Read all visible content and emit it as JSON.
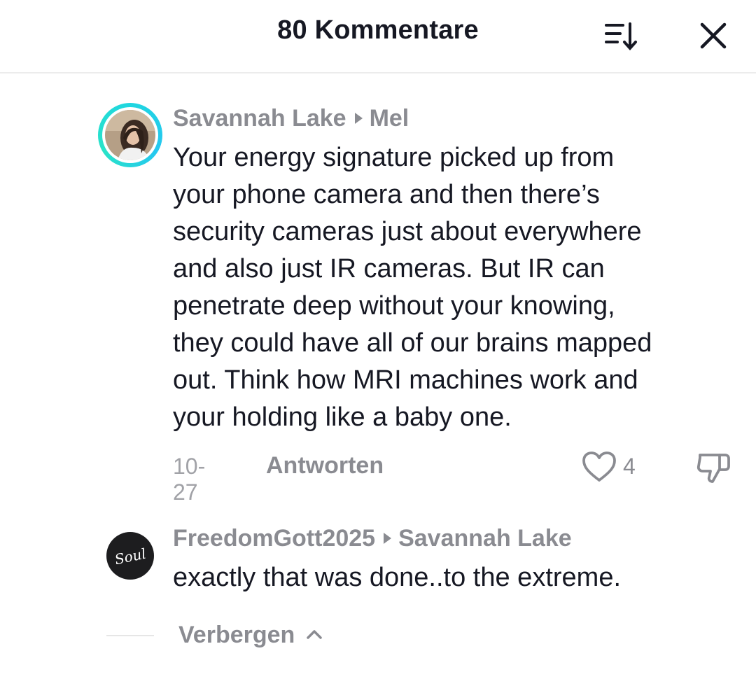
{
  "header": {
    "title": "80 Kommentare",
    "sort_icon": "sort-icon",
    "close_icon": "close-icon"
  },
  "comments": [
    {
      "author": "Savannah Lake",
      "reply_to": "Mel",
      "text_lines": [
        "Your energy signature picked up from",
        "your phone camera and then there’s",
        "security cameras just about everywhere",
        "and also just IR cameras. But IR can",
        "penetrate deep without your knowing,",
        "they could have all of our brains mapped",
        "out. Think how MRI machines work and",
        "your holding like a baby one."
      ],
      "date": "10-27",
      "reply_label": "Antworten",
      "likes": "4"
    },
    {
      "author": "FreedomGott2025",
      "reply_to": "Savannah Lake",
      "text": "exactly that was done..to the extreme.",
      "avatar_text": "Soul"
    }
  ],
  "footer": {
    "hide_label": "Verbergen"
  },
  "colors": {
    "text_primary": "#161823",
    "text_secondary": "#8a8b91",
    "ring_accent": "#1fd6e0"
  }
}
